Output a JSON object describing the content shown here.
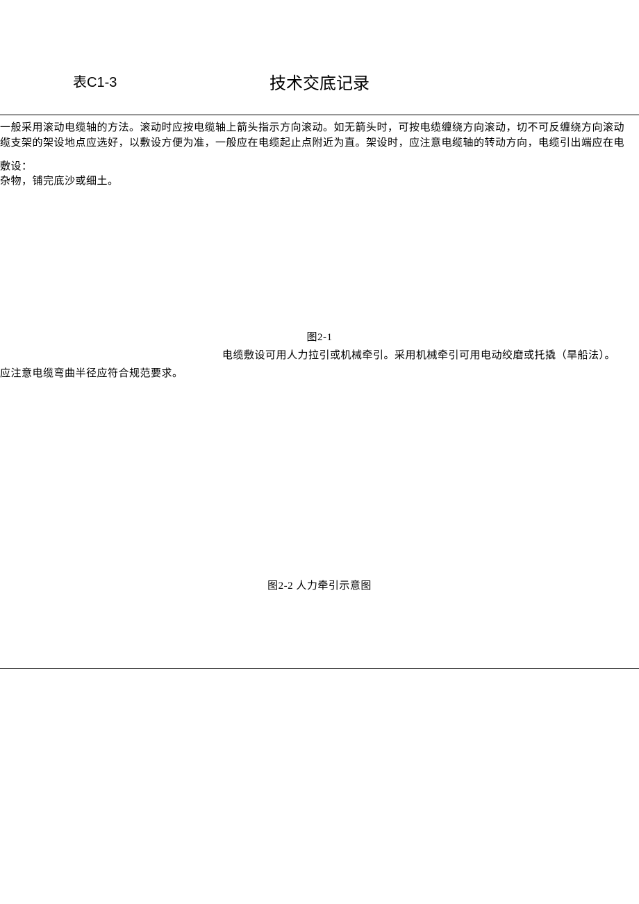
{
  "header": {
    "table_label": "表C1-3",
    "title": "技术交底记录"
  },
  "body": {
    "para1": "一般采用滚动电缆轴的方法。滚动时应按电缆轴上箭头指示方向滚动。如无箭头时，可按电缆缠绕方向滚动，切不可反缠绕方向滚动",
    "para2": "缆支架的架设地点应选好，以敷设方便为准，一般应在电缆起止点附近为直。架设时，应注意电缆轴的转动方向，电缆引出端应在电",
    "para3": "敷设：",
    "para4": "杂物，铺完底沙或细土。",
    "figure_caption_1": "图2-1",
    "para5": "电缆敷设可用人力拉引或机械牵引。采用机械牵引可用电动绞磨或托撬（旱船法）。",
    "para6": "应注意电缆弯曲半径应符合规范要求。",
    "figure_caption_2": "图2-2  人力牵引示意图"
  }
}
